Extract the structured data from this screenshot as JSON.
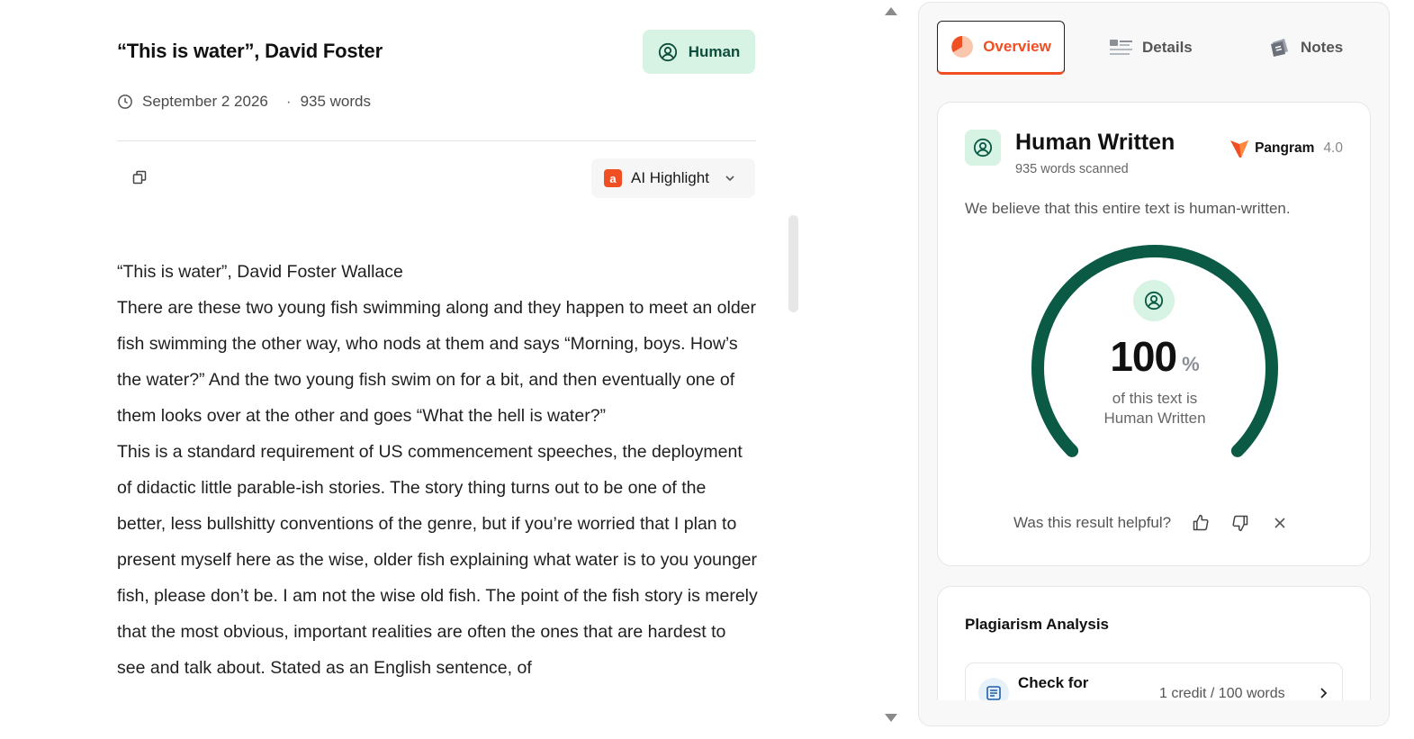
{
  "document": {
    "title": "“This is water”, David Foster",
    "badge_label": "Human",
    "date": "September 2 2026",
    "separator": "·",
    "word_count": "935 words",
    "ai_highlight_label": "AI Highlight",
    "ai_logo_letter": "a",
    "paragraphs": [
      "“This is water”, David Foster Wallace",
      "There are these two young fish swimming along and they happen to meet an older fish swimming the other way, who nods at them and says “Morning, boys. How’s the water?” And the two young fish swim on for a bit, and then eventually one of them looks over at the other and goes “What the hell is water?”",
      "This is a standard requirement of US commencement speeches, the deployment of didactic little parable-ish stories. The story thing turns out to be one of the better, less bullshitty conventions of the genre, but if you’re worried that I plan to present myself here as the wise, older fish explaining what water is to you younger fish, please don’t be. I am not the wise old fish. The point of the fish story is merely that the most obvious, important realities are often the ones that are hardest to see and talk about. Stated as an English sentence, of"
    ]
  },
  "tabs": [
    {
      "label": "Overview",
      "icon": "pie-chart-icon",
      "active": true
    },
    {
      "label": "Details",
      "icon": "list-icon",
      "active": false
    },
    {
      "label": "Notes",
      "icon": "notes-icon",
      "active": false
    }
  ],
  "result": {
    "title": "Human Written",
    "subtitle": "935 words scanned",
    "brand_name": "Pangram",
    "brand_version": "4.0",
    "description": "We believe that this entire text is human-written.",
    "score": "100",
    "score_unit": "%",
    "score_fraction": 1.0,
    "score_label_line1": "of this text is",
    "score_label_line2": "Human Written",
    "feedback_question": "Was this result helpful?"
  },
  "plagiarism": {
    "title": "Plagiarism Analysis",
    "row_label": "Check for",
    "row_cost": "1 credit / 100 words"
  },
  "colors": {
    "accent": "#f04e23",
    "human_green": "#0b5a45",
    "badge_bg": "#d6f3e4"
  }
}
